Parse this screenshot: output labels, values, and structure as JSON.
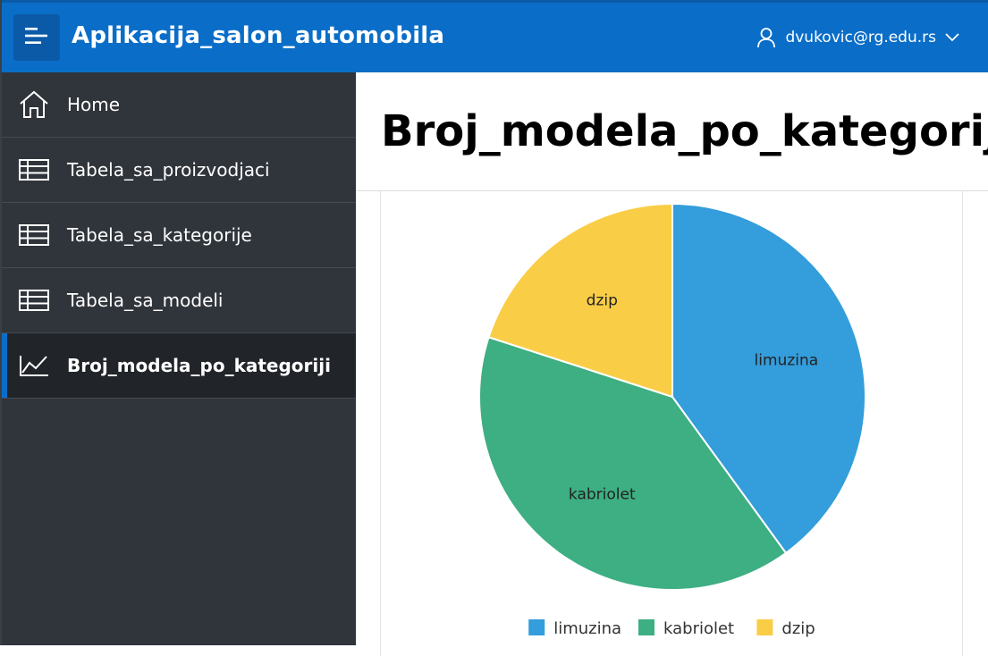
{
  "header": {
    "app_title": "Aplikacija_salon_automobila",
    "user": "dvukovic@rg.edu.rs",
    "menu_icon": "hamburger-menu-icon",
    "user_icon": "user-icon",
    "chevron_icon": "chevron-down-icon"
  },
  "sidebar": {
    "items": [
      {
        "label": "Home",
        "icon": "home-icon",
        "active": false
      },
      {
        "label": "Tabela_sa_proizvodjaci",
        "icon": "table-icon",
        "active": false
      },
      {
        "label": "Tabela_sa_kategorije",
        "icon": "table-icon",
        "active": false
      },
      {
        "label": "Tabela_sa_modeli",
        "icon": "table-icon",
        "active": false
      },
      {
        "label": "Broj_modela_po_kategoriji",
        "icon": "line-chart-icon",
        "active": true
      }
    ]
  },
  "page": {
    "title": "Broj_modela_po_kategoriji"
  },
  "colors": {
    "header_bg": "#0a6ec8",
    "sidebar_bg": "#30343b",
    "sidebar_active_bg": "#212428",
    "accent": "#0a6ec8",
    "limuzina": "#349ddb",
    "kabriolet": "#3daf82",
    "dzip": "#f9ce46"
  },
  "chart_data": {
    "type": "pie",
    "title": "",
    "categories": [
      "limuzina",
      "kabriolet",
      "dzip"
    ],
    "values": [
      2,
      2,
      1
    ],
    "colors": [
      "#349ddb",
      "#3daf82",
      "#f9ce46"
    ],
    "data_labels": [
      "limuzina",
      "kabriolet",
      "dzip"
    ],
    "legend": {
      "position": "bottom",
      "entries": [
        "limuzina",
        "kabriolet",
        "dzip"
      ]
    }
  }
}
